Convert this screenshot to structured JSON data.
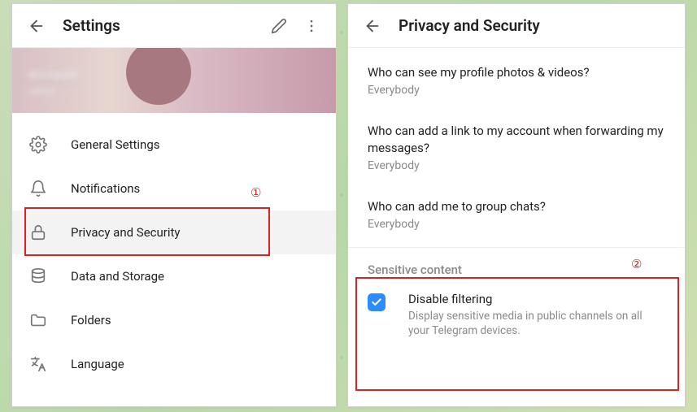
{
  "left": {
    "title": "Settings",
    "profile_name": "Account",
    "profile_sub": "online",
    "menu": [
      {
        "icon": "gear-icon",
        "label": "General Settings"
      },
      {
        "icon": "bell-icon",
        "label": "Notifications"
      },
      {
        "icon": "lock-icon",
        "label": "Privacy and Security",
        "active": true
      },
      {
        "icon": "database-icon",
        "label": "Data and Storage"
      },
      {
        "icon": "folder-icon",
        "label": "Folders"
      },
      {
        "icon": "language-icon",
        "label": "Language"
      }
    ]
  },
  "right": {
    "title": "Privacy and Security",
    "items": [
      {
        "question": "Who can see my profile photos & videos?",
        "value": "Everybody"
      },
      {
        "question": "Who can add a link to my account when forwarding my messages?",
        "value": "Everybody"
      },
      {
        "question": "Who can add me to group chats?",
        "value": "Everybody"
      }
    ],
    "sensitive": {
      "header": "Sensitive content",
      "title": "Disable filtering",
      "desc": "Display sensitive media in public channels on all your Telegram devices.",
      "checked": true
    }
  },
  "annotations": {
    "one": "①",
    "two": "②"
  }
}
